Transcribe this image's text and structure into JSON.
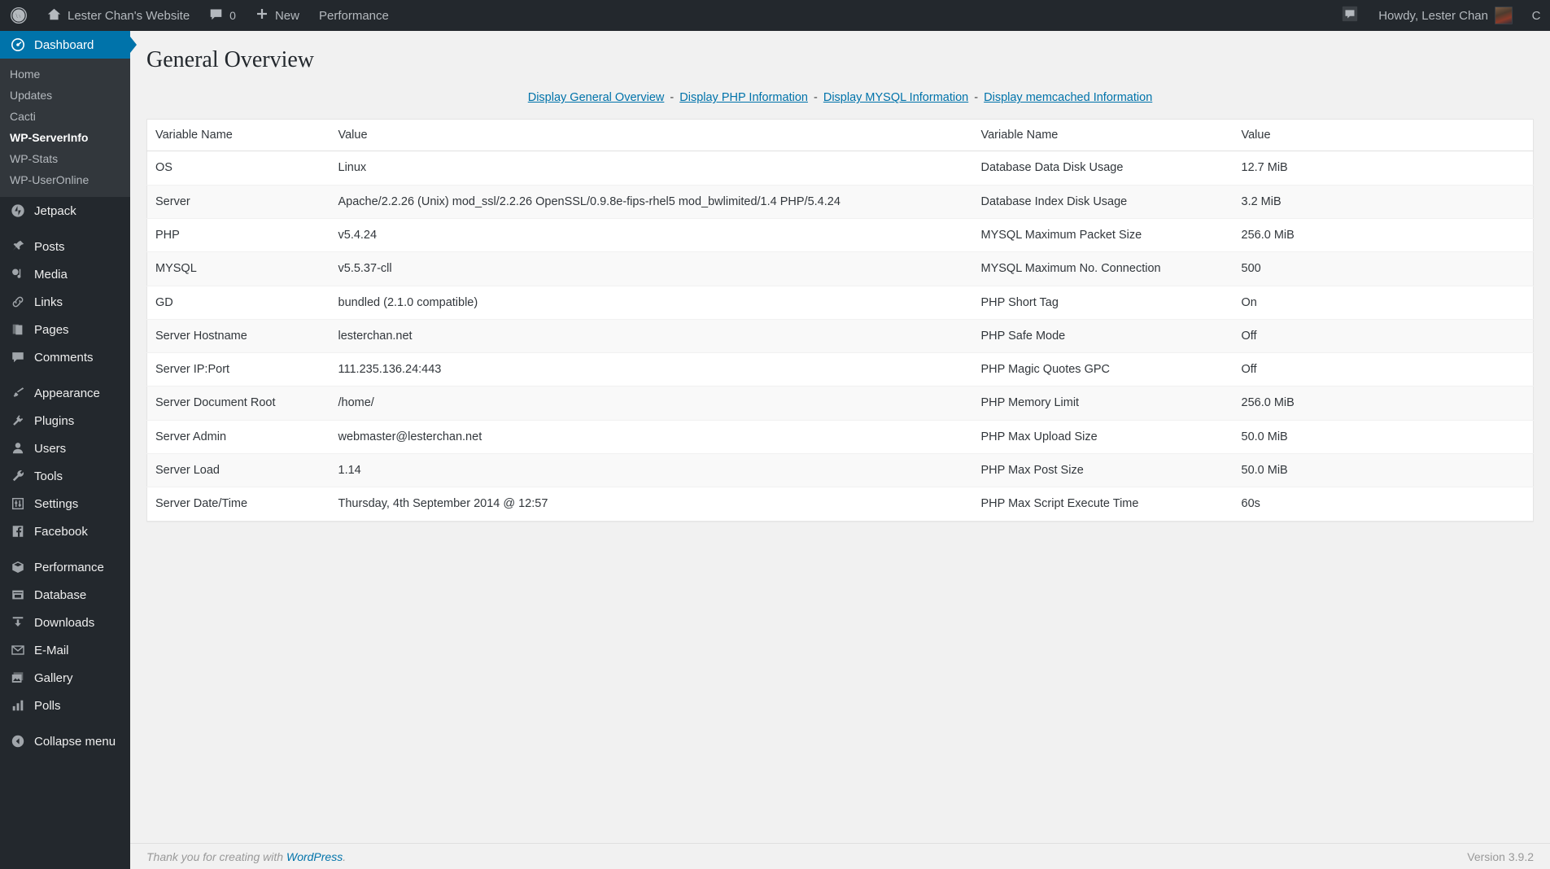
{
  "adminbar": {
    "logo_icon": "wordpress-logo-icon",
    "site_home_icon": "home-icon",
    "site_name": "Lester Chan's Website",
    "comments_icon": "comment-bubble-icon",
    "comments_count": "0",
    "new_icon": "plus-icon",
    "new_label": "New",
    "performance_label": "Performance",
    "notification_icon": "comment-bubble-icon",
    "howdy": "Howdy, Lester Chan",
    "avatar_name": "user-avatar",
    "edge_label": "C"
  },
  "sidebar": {
    "items": [
      {
        "label": "Dashboard",
        "icon": "dashboard-icon",
        "current": true,
        "name": "dashboard"
      },
      {
        "label": "Jetpack",
        "icon": "jetpack-icon",
        "current": false,
        "name": "jetpack",
        "sep_before": true
      },
      {
        "label": "Posts",
        "icon": "pin-icon",
        "current": false,
        "name": "posts",
        "sep_before": true
      },
      {
        "label": "Media",
        "icon": "media-icon",
        "current": false,
        "name": "media"
      },
      {
        "label": "Links",
        "icon": "link-icon",
        "current": false,
        "name": "links"
      },
      {
        "label": "Pages",
        "icon": "pages-icon",
        "current": false,
        "name": "pages"
      },
      {
        "label": "Comments",
        "icon": "comment-bubble-icon",
        "current": false,
        "name": "comments"
      },
      {
        "label": "Appearance",
        "icon": "paintbrush-icon",
        "current": false,
        "name": "appearance",
        "sep_before": true
      },
      {
        "label": "Plugins",
        "icon": "plugin-icon",
        "current": false,
        "name": "plugins"
      },
      {
        "label": "Users",
        "icon": "user-icon",
        "current": false,
        "name": "users"
      },
      {
        "label": "Tools",
        "icon": "wrench-icon",
        "current": false,
        "name": "tools"
      },
      {
        "label": "Settings",
        "icon": "sliders-icon",
        "current": false,
        "name": "settings"
      },
      {
        "label": "Facebook",
        "icon": "facebook-icon",
        "current": false,
        "name": "facebook"
      },
      {
        "label": "Performance",
        "icon": "performance-cube-icon",
        "current": false,
        "name": "performance",
        "sep_before": true
      },
      {
        "label": "Database",
        "icon": "database-icon",
        "current": false,
        "name": "database"
      },
      {
        "label": "Downloads",
        "icon": "download-icon",
        "current": false,
        "name": "downloads"
      },
      {
        "label": "E-Mail",
        "icon": "envelope-icon",
        "current": false,
        "name": "email"
      },
      {
        "label": "Gallery",
        "icon": "gallery-icon",
        "current": false,
        "name": "gallery"
      },
      {
        "label": "Polls",
        "icon": "bar-chart-icon",
        "current": false,
        "name": "polls"
      },
      {
        "label": "Collapse menu",
        "icon": "collapse-arrow-icon",
        "current": false,
        "name": "collapse-menu",
        "sep_before": true
      }
    ],
    "submenu": {
      "parent": "Dashboard",
      "items": [
        {
          "label": "Home",
          "current": false
        },
        {
          "label": "Updates",
          "current": false
        },
        {
          "label": "Cacti",
          "current": false
        },
        {
          "label": "WP-ServerInfo",
          "current": true
        },
        {
          "label": "WP-Stats",
          "current": false
        },
        {
          "label": "WP-UserOnline",
          "current": false
        }
      ]
    }
  },
  "main": {
    "page_title": "General Overview",
    "nav_links": [
      "Display General Overview",
      "Display PHP Information",
      "Display MYSQL Information",
      "Display memcached Information"
    ],
    "nav_separator": "-",
    "table": {
      "headers": [
        "Variable Name",
        "Value",
        "Variable Name",
        "Value"
      ],
      "rows": [
        [
          "OS",
          "Linux",
          "Database Data Disk Usage",
          "12.7 MiB"
        ],
        [
          "Server",
          "Apache/2.2.26 (Unix) mod_ssl/2.2.26 OpenSSL/0.9.8e-fips-rhel5 mod_bwlimited/1.4 PHP/5.4.24",
          "Database Index Disk Usage",
          "3.2 MiB"
        ],
        [
          "PHP",
          "v5.4.24",
          "MYSQL Maximum Packet Size",
          "256.0 MiB"
        ],
        [
          "MYSQL",
          "v5.5.37-cll",
          "MYSQL Maximum No. Connection",
          "500"
        ],
        [
          "GD",
          "bundled (2.1.0 compatible)",
          "PHP Short Tag",
          "On"
        ],
        [
          "Server Hostname",
          "lesterchan.net",
          "PHP Safe Mode",
          "Off"
        ],
        [
          "Server IP:Port",
          "111.235.136.24:443",
          "PHP Magic Quotes GPC",
          "Off"
        ],
        [
          "Server Document Root",
          "/home/",
          "PHP Memory Limit",
          "256.0 MiB"
        ],
        [
          "Server Admin",
          "webmaster@lesterchan.net",
          "PHP Max Upload Size",
          "50.0 MiB"
        ],
        [
          "Server Load",
          "1.14",
          "PHP Max Post Size",
          "50.0 MiB"
        ],
        [
          "Server Date/Time",
          "Thursday, 4th September 2014 @ 12:57",
          "PHP Max Script Execute Time",
          "60s"
        ]
      ]
    }
  },
  "footer": {
    "thanks_prefix": "Thank you for creating with ",
    "wordpress_link": "WordPress",
    "thanks_suffix": ".",
    "version": "Version 3.9.2"
  },
  "colors": {
    "accent_blue": "#0073aa",
    "link_blue": "#0073aa",
    "sidebar_bg": "#23282d",
    "submenu_bg": "#32373c",
    "page_bg": "#f1f1f1"
  }
}
